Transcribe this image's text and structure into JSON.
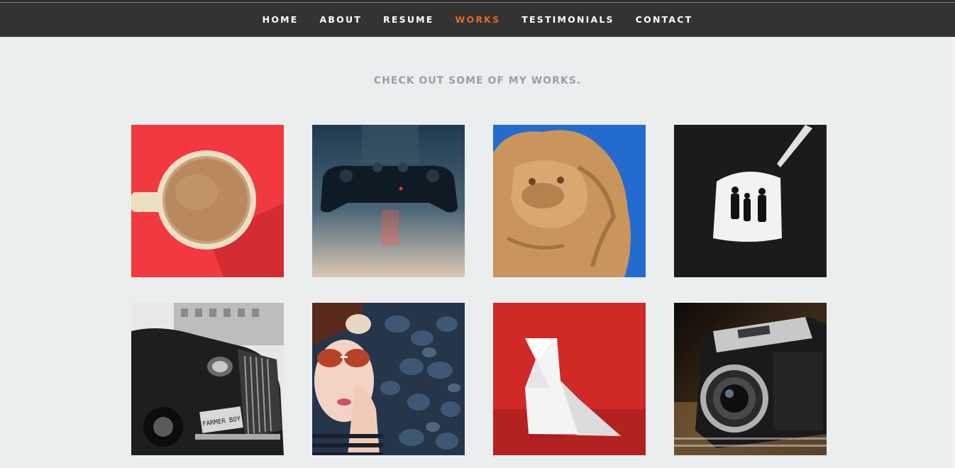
{
  "nav": {
    "items": [
      {
        "label": "HOME",
        "active": false
      },
      {
        "label": "ABOUT",
        "active": false
      },
      {
        "label": "RESUME",
        "active": false
      },
      {
        "label": "WORKS",
        "active": true
      },
      {
        "label": "TESTIMONIALS",
        "active": false
      },
      {
        "label": "CONTACT",
        "active": false
      }
    ],
    "active_color": "#e46a1d"
  },
  "works": {
    "heading": "CHECK OUT SOME OF MY WORKS.",
    "items": [
      {
        "subject": "coffee-cup"
      },
      {
        "subject": "game-controller"
      },
      {
        "subject": "lion-statue"
      },
      {
        "subject": "cave-silhouettes"
      },
      {
        "subject": "vintage-car",
        "plate_text": "FARMER BOY"
      },
      {
        "subject": "woman-sunglasses"
      },
      {
        "subject": "origami-bird"
      },
      {
        "subject": "vintage-camera"
      }
    ]
  }
}
